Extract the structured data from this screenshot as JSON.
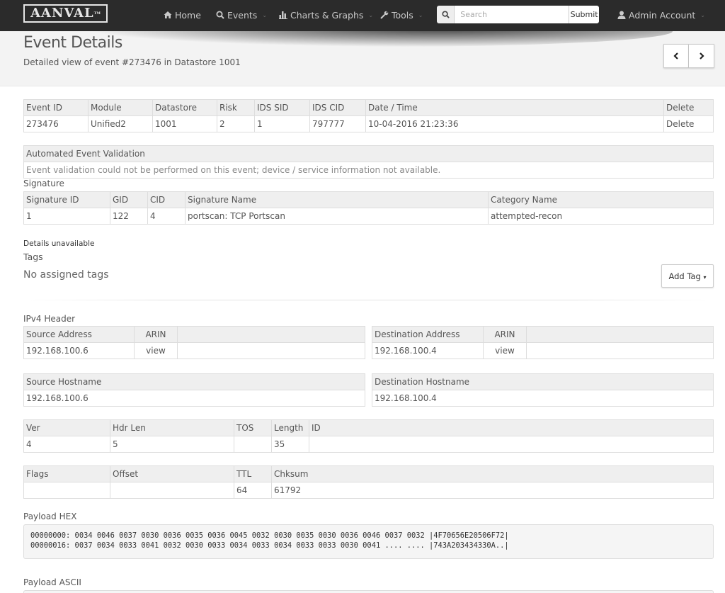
{
  "navbar": {
    "logo": "AANVAL",
    "logo_tm": "TM",
    "items": [
      {
        "label": "Home",
        "icon": "home-icon",
        "has_caret": false
      },
      {
        "label": "Events",
        "icon": "search-icon",
        "has_caret": true
      },
      {
        "label": "Charts & Graphs",
        "icon": "bar-chart-icon",
        "has_caret": true
      },
      {
        "label": "Tools",
        "icon": "wrench-icon",
        "has_caret": true
      }
    ],
    "search": {
      "placeholder": "Search",
      "value": "",
      "submit_label": "Submit"
    },
    "account": {
      "label": "Admin Account",
      "icon": "user-icon",
      "has_caret": true
    },
    "caret": "⌄"
  },
  "header": {
    "title": "Event Details",
    "subtitle": "Detailed view of event #273476 in Datastore 1001",
    "prev_icon": "chevron-left-icon",
    "next_icon": "chevron-right-icon"
  },
  "event_table": {
    "headers": [
      "Event ID",
      "Module",
      "Datastore",
      "Risk",
      "IDS SID",
      "IDS CID",
      "Date / Time",
      "Delete"
    ],
    "row": [
      "273476",
      "Unified2",
      "1001",
      "2",
      "1",
      "797777",
      "10-04-2016 21:23:36",
      "Delete"
    ]
  },
  "validation": {
    "header": "Automated Event Validation",
    "message": "Event validation could not be performed on this event; device / service information not available."
  },
  "signature": {
    "title": "Signature",
    "headers": [
      "Signature ID",
      "GID",
      "CID",
      "Signature Name",
      "Category Name"
    ],
    "row": [
      "1",
      "122",
      "4",
      "portscan: TCP Portscan",
      "attempted-recon"
    ]
  },
  "details_unavailable": "Details unavailable",
  "tags": {
    "title": "Tags",
    "empty_text": "No assigned tags",
    "add_button": "Add Tag",
    "add_caret": "▾"
  },
  "ipv4": {
    "title": "IPv4 Header",
    "source": {
      "header": "Source Address",
      "arin_header": "ARIN",
      "address": "192.168.100.6",
      "arin_link": "view"
    },
    "destination": {
      "header": "Destination Address",
      "arin_header": "ARIN",
      "address": "192.168.100.4",
      "arin_link": "view"
    },
    "source_hostname": {
      "header": "Source Hostname",
      "value": "192.168.100.6"
    },
    "destination_hostname": {
      "header": "Destination Hostname",
      "value": "192.168.100.4"
    },
    "fields1": {
      "headers": [
        "Ver",
        "Hdr Len",
        "TOS",
        "Length",
        "ID"
      ],
      "row": [
        "4",
        "5",
        "",
        "35",
        ""
      ]
    },
    "fields2": {
      "headers": [
        "Flags",
        "Offset",
        "TTL",
        "Chksum"
      ],
      "row": [
        "",
        "",
        "64",
        "61792"
      ]
    }
  },
  "payload_hex": {
    "title": "Payload HEX",
    "lines": [
      "00000000: 0034 0046 0037 0030 0036 0035 0036 0045 0032 0030 0035 0030 0036 0046 0037 0032 |4F70656E20506F72|",
      "00000016: 0037 0034 0033 0041 0032 0030 0033 0034 0033 0034 0033 0033 0030 0041 .... .... |743A203434330A..|"
    ]
  },
  "payload_ascii": {
    "title": "Payload ASCII"
  }
}
